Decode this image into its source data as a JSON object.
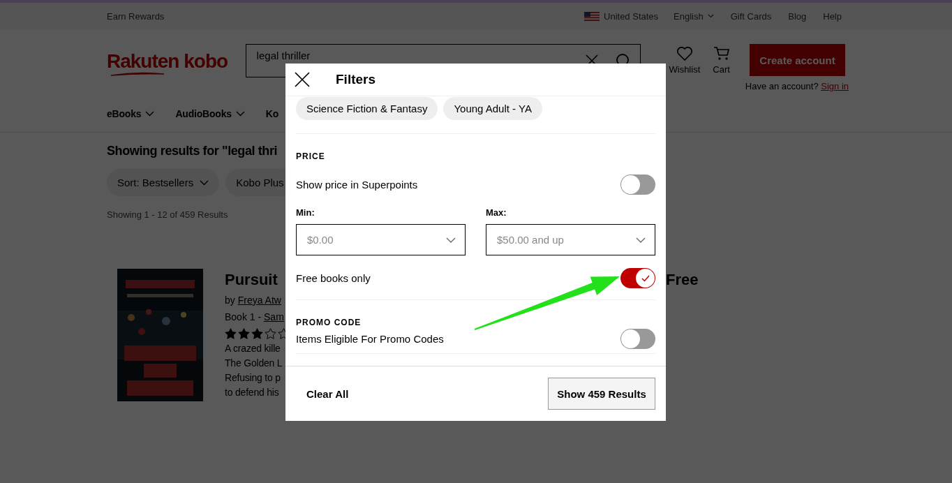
{
  "top_bar": {
    "rewards": "Earn Rewards",
    "country": "United States",
    "language": "English",
    "links": [
      "Gift Cards",
      "Blog",
      "Help"
    ]
  },
  "header": {
    "logo": "Rakuten kobo",
    "search": {
      "value": "legal thriller"
    },
    "wishlist": "Wishlist",
    "cart": "Cart",
    "create_account": "Create account",
    "have_account": "Have an account?",
    "sign_in": "Sign in"
  },
  "nav": [
    {
      "label": "eBooks",
      "dropdown": true
    },
    {
      "label": "AudioBooks",
      "dropdown": true
    },
    {
      "label": "Ko",
      "dropdown": false
    }
  ],
  "results": {
    "heading": "Showing results for \"legal thri",
    "sort": "Sort: Bestsellers",
    "chips": [
      "Kobo Plus"
    ],
    "count": "Showing 1 - 12 of 459 Results"
  },
  "book": {
    "title": "Pursuit",
    "by": "by",
    "author": "Freya Atw",
    "book_no": "Book 1 -",
    "series": "Sam",
    "stars": 3,
    "description": [
      "A crazed kille",
      "The Golden L",
      "Refusing to p",
      "to defend his"
    ],
    "price": "Free"
  },
  "filters": {
    "title": "Filters",
    "categories": [
      "Science Fiction & Fantasy",
      "Young Adult - YA"
    ],
    "price": {
      "heading": "PRICE",
      "superpoints": {
        "label": "Show price in Superpoints",
        "on": false
      },
      "min": {
        "label": "Min:",
        "value": "$0.00"
      },
      "max": {
        "label": "Max:",
        "value": "$50.00 and up"
      },
      "free_only": {
        "label": "Free books only",
        "on": true
      }
    },
    "promo": {
      "heading": "PROMO CODE",
      "eligible": {
        "label": "Items Eligible For Promo Codes",
        "on": false
      }
    },
    "clear": "Clear All",
    "show": "Show 459 Results"
  }
}
